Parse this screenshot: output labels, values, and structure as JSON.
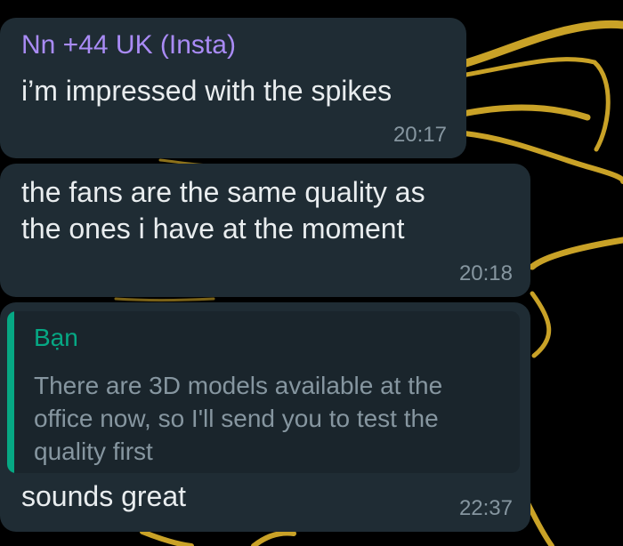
{
  "messages": [
    {
      "sender": "Nn +44 UK (Insta)",
      "lines": [
        "i’m impressed with the spikes"
      ],
      "time": "20:17"
    },
    {
      "lines": [
        "the fans are the same quality as",
        "the ones i have at the moment"
      ],
      "time": "20:18"
    },
    {
      "quote": {
        "author": "Bạn",
        "lines": [
          "There are 3D models available at the",
          "office now, so I'll send you to test the",
          "quality first"
        ]
      },
      "lines": [
        "sounds great"
      ],
      "time": "22:37"
    }
  ],
  "colors": {
    "background": "#000000",
    "bubble": "#1f2c34",
    "sender_name": "#a98bf5",
    "quote_accent": "#06a884",
    "timestamp": "#8696a0",
    "wallpaper_gold": "#c9a227"
  },
  "wallpaper": "gold-ribbon-doodle"
}
